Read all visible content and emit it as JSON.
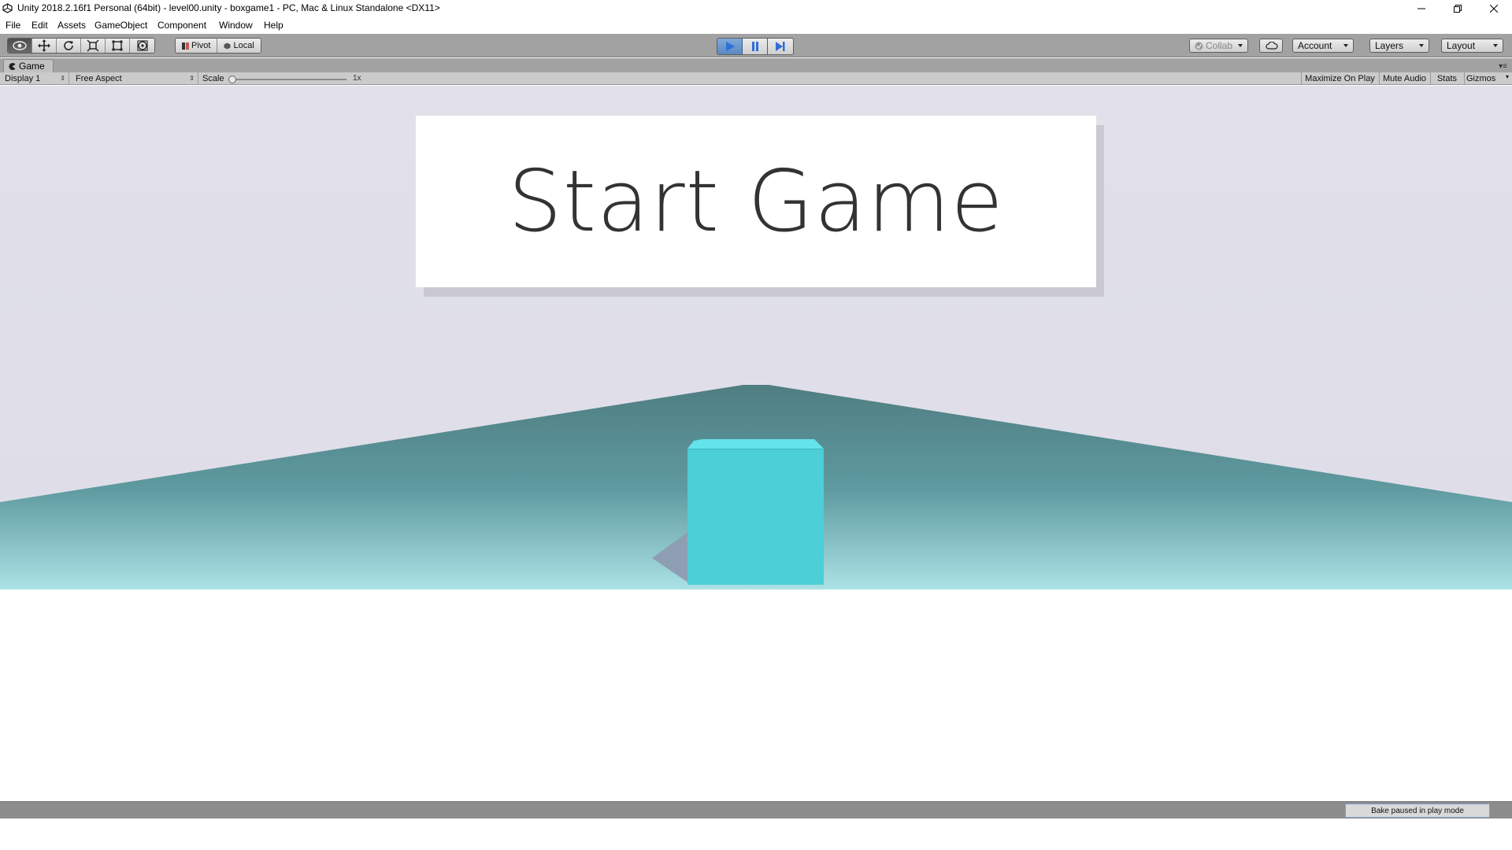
{
  "window": {
    "title": "Unity 2018.2.16f1 Personal (64bit) - level00.unity - boxgame1 - PC, Mac & Linux Standalone <DX11>",
    "controls": [
      "minimize-icon",
      "restore-icon",
      "close-icon"
    ]
  },
  "menu": {
    "items": [
      {
        "label": "File"
      },
      {
        "label": "Edit"
      },
      {
        "label": "Assets"
      },
      {
        "label": "GameObject"
      },
      {
        "label": "Component"
      },
      {
        "label": "Window"
      },
      {
        "label": "Help"
      }
    ]
  },
  "toolbar": {
    "transform_tools": [
      "hand-view-icon",
      "move-icon",
      "rotate-icon",
      "scale-icon",
      "rect-tool-icon",
      "transform-tool-icon"
    ],
    "active_tool": "hand-view-icon",
    "pivot_label": "Pivot",
    "local_label": "Local",
    "play_controls": [
      "play-icon",
      "pause-icon",
      "step-icon"
    ],
    "collab_label": "Collab",
    "account_label": "Account",
    "layers_label": "Layers",
    "layout_label": "Layout",
    "accent_color": "#2f6fd8"
  },
  "game_view": {
    "tab_label": "Game",
    "display_label": "Display 1",
    "aspect_label": "Free Aspect",
    "scale_label": "Scale",
    "scale_value": "1x",
    "maximize_label": "Maximize On Play",
    "mute_label": "Mute Audio",
    "stats_label": "Stats",
    "gizmos_label": "Gizmos"
  },
  "scene": {
    "start_button_label": "Start Game",
    "cube_color": "#4ccfd6",
    "sky_color": "#e1e0ea",
    "floor_horizon_color": "#4f7e82"
  },
  "status": {
    "message": "Bake paused in play mode"
  }
}
